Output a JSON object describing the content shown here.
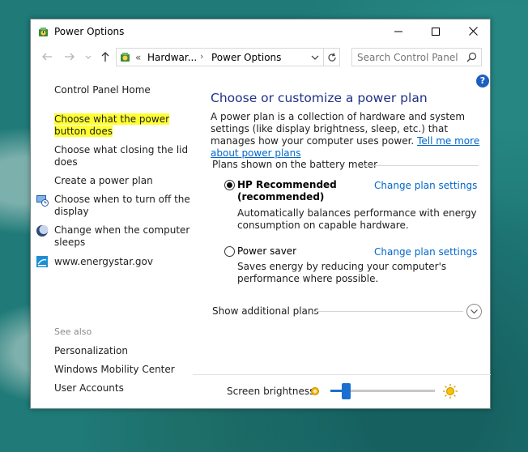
{
  "window": {
    "title": "Power Options",
    "buttons": {
      "minimize": "minimize",
      "maximize": "maximize",
      "close": "close"
    }
  },
  "nav": {
    "overflow": "«",
    "crumb1": "Hardwar...",
    "sep": "›",
    "crumb2": "Power Options",
    "search_placeholder": "Search Control Panel"
  },
  "sidebar": {
    "home": "Control Panel Home",
    "items": [
      {
        "label": "Choose what the power button does",
        "highlighted": true
      },
      {
        "label": "Choose what closing the lid does"
      },
      {
        "label": "Create a power plan"
      },
      {
        "label": "Choose when to turn off the display",
        "icon": "monitor-clock-icon"
      },
      {
        "label": "Change when the computer sleeps",
        "icon": "moon-icon"
      },
      {
        "label": "www.energystar.gov",
        "icon": "energystar-icon"
      }
    ],
    "see_also": "See also",
    "see_also_items": [
      "Personalization",
      "Windows Mobility Center",
      "User Accounts"
    ]
  },
  "main": {
    "heading": "Choose or customize a power plan",
    "intro": "A power plan is a collection of hardware and system settings (like display brightness, sleep, etc.) that manages how your computer uses power.",
    "intro_link": "Tell me more about power plans",
    "section_title": "Plans shown on the battery meter",
    "plans": [
      {
        "name_line1": "HP Recommended",
        "name_line2": "(recommended)",
        "selected": true,
        "description": "Automatically balances performance with energy consumption on capable hardware.",
        "change_label": "Change plan settings"
      },
      {
        "name_line1": "Power saver",
        "selected": false,
        "description": "Saves energy by reducing your computer's performance where possible.",
        "change_label": "Change plan settings"
      }
    ],
    "show_more": "Show additional plans",
    "brightness_label": "Screen brightness:",
    "brightness_level": 0.15
  },
  "colors": {
    "accent": "#1c6fd1",
    "link": "#0066cc",
    "heading": "#1e3287",
    "highlight": "#ffff33"
  }
}
